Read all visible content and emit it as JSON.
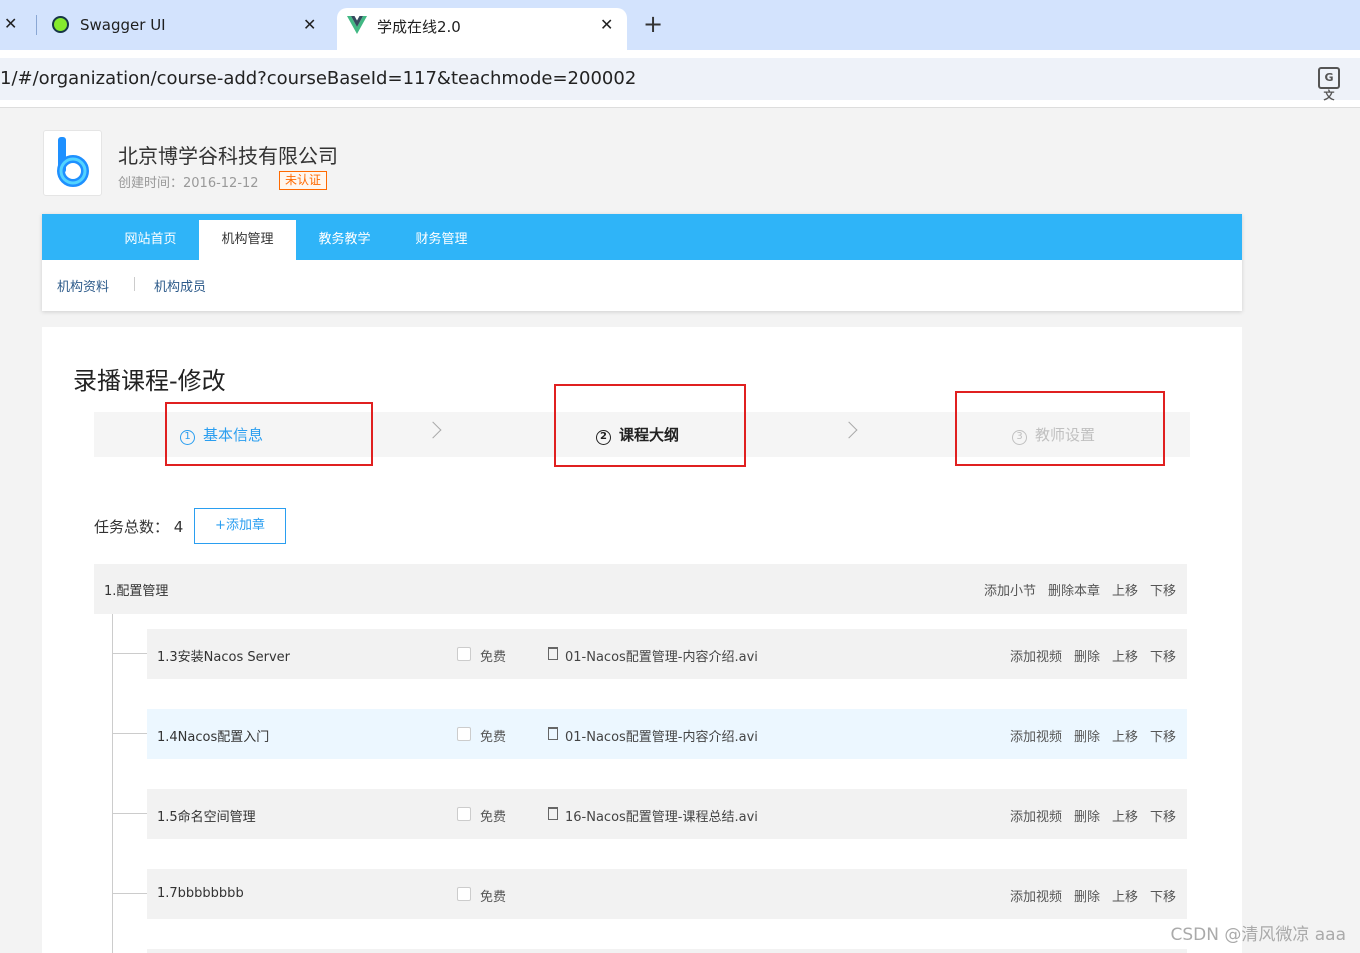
{
  "browser": {
    "tabs": [
      {
        "title": "Swagger UI"
      },
      {
        "title": "学成在线2.0"
      }
    ],
    "url": "1/#/organization/course-add?courseBaseId=117&teachmode=200002",
    "close_glyph": "✕",
    "new_tab_glyph": "+",
    "translate_glyph": "G文"
  },
  "org": {
    "name": "北京博学谷科技有限公司",
    "created": "创建时间：2016-12-12",
    "badge": "未认证"
  },
  "nav": {
    "items": [
      "网站首页",
      "机构管理",
      "教务教学",
      "财务管理"
    ],
    "active_index": 1,
    "subitems": [
      "机构资料",
      "机构成员"
    ]
  },
  "page": {
    "title": "录播课程-修改"
  },
  "steps": [
    {
      "num": "1",
      "label": "基本信息"
    },
    {
      "num": "2",
      "label": "课程大纲"
    },
    {
      "num": "3",
      "label": "教师设置"
    }
  ],
  "tasks": {
    "label": "任务总数：",
    "count": "4",
    "add_chapter": "+添加章"
  },
  "chapter": {
    "title": "1.配置管理",
    "actions": [
      "添加小节",
      "删除本章",
      "上移",
      "下移"
    ]
  },
  "sections": [
    {
      "title": "1.3安装Nacos Server",
      "free": "免费",
      "video": "01-Nacos配置管理-内容介绍.avi",
      "actions": [
        "添加视频",
        "删除",
        "上移",
        "下移"
      ]
    },
    {
      "title": "1.4Nacos配置入门",
      "free": "免费",
      "video": "01-Nacos配置管理-内容介绍.avi",
      "actions": [
        "添加视频",
        "删除",
        "上移",
        "下移"
      ]
    },
    {
      "title": "1.5命名空间管理",
      "free": "免费",
      "video": "16-Nacos配置管理-课程总结.avi",
      "actions": [
        "添加视频",
        "删除",
        "上移",
        "下移"
      ]
    },
    {
      "title": "1.7bbbbbbbb",
      "free": "免费",
      "video": "",
      "actions": [
        "添加视频",
        "删除",
        "上移",
        "下移"
      ]
    }
  ],
  "watermark": "CSDN @清风微凉 aaa",
  "colors": {
    "nav_blue": "#2fb4f8",
    "link_blue": "#2a9ef0",
    "highlight_red": "#e02020",
    "badge_orange": "#ff6a00"
  }
}
